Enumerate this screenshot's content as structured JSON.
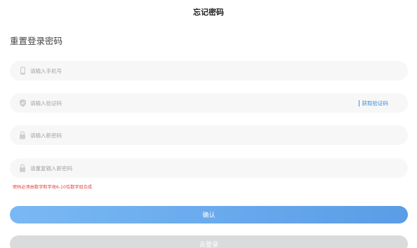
{
  "header": {
    "title": "忘记密码"
  },
  "form": {
    "section_title": "重置登录密码",
    "phone": {
      "placeholder": "请输入手机号",
      "icon": "phone-icon"
    },
    "code": {
      "placeholder": "请输入验证码",
      "icon": "shield-icon",
      "get_code_label": "获取验证码"
    },
    "new_password": {
      "placeholder": "请输入新密码",
      "icon": "lock-icon"
    },
    "confirm_password": {
      "placeholder": "请重复输入新密码",
      "icon": "lock-icon"
    },
    "hint": "密码必须由数字和字母6-10位数字组合成"
  },
  "actions": {
    "confirm_label": "确认",
    "login_label": "去登录"
  },
  "colors": {
    "primary": "#5a9de6",
    "link": "#3d8fdc",
    "error": "#e0413b",
    "field_bg": "#f7f7f7",
    "disabled_button": "#dadbdd"
  }
}
